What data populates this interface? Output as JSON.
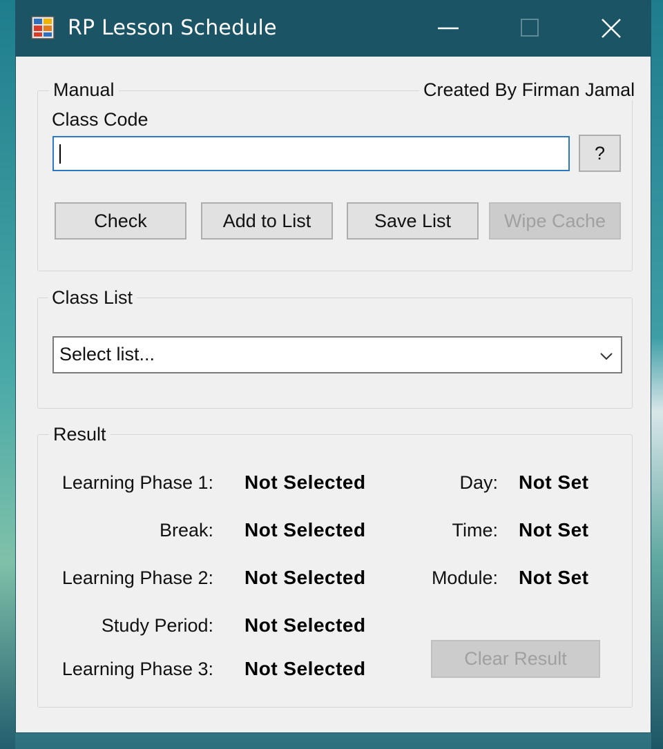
{
  "window": {
    "title": "RP Lesson Schedule",
    "icons": {
      "app": "app-grid-icon",
      "minimize": "minimize-icon",
      "maximize": "maximize-icon",
      "close": "close-icon"
    }
  },
  "manual": {
    "group_title": "Manual",
    "credit": "Created By Firman Jamal",
    "class_code_label": "Class Code",
    "class_code_value": "",
    "help_button": "?",
    "buttons": {
      "check": "Check",
      "add_to_list": "Add to List",
      "save_list": "Save List",
      "wipe_cache": "Wipe Cache"
    }
  },
  "class_list": {
    "group_title": "Class List",
    "selected": "Select list..."
  },
  "result": {
    "group_title": "Result",
    "rows": [
      {
        "label": "Learning Phase 1:",
        "value": "Not Selected"
      },
      {
        "label": "Break:",
        "value": "Not Selected"
      },
      {
        "label": "Learning Phase 2:",
        "value": "Not Selected"
      },
      {
        "label": "Study Period:",
        "value": "Not Selected"
      },
      {
        "label": "Learning Phase 3:",
        "value": "Not Selected"
      }
    ],
    "info": [
      {
        "label": "Day:",
        "value": "Not Set"
      },
      {
        "label": "Time:",
        "value": "Not Set"
      },
      {
        "label": "Module:",
        "value": "Not Set"
      }
    ],
    "clear_button": "Clear Result"
  },
  "colors": {
    "titlebar": "#1b5465",
    "focus_border": "#2b79c2",
    "window_bg": "#f0f0f0"
  }
}
